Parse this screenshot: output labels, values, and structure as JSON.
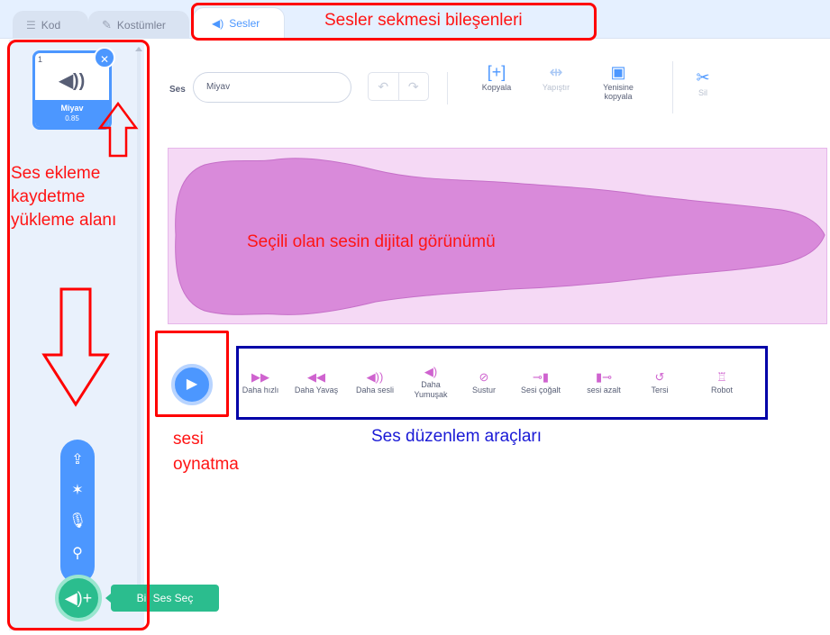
{
  "tabs": {
    "code": {
      "label": "Kod",
      "icon": "code-icon"
    },
    "costumes": {
      "label": "Kostümler",
      "icon": "brush-icon"
    },
    "sounds": {
      "label": "Sesler",
      "icon": "speaker-icon"
    }
  },
  "sound_list": {
    "items": [
      {
        "index": "1",
        "name": "Miyav",
        "duration": "0.85"
      }
    ],
    "delete_icon": "trash-icon",
    "add_menu": {
      "items": [
        "upload-icon",
        "surprise-icon",
        "record-icon",
        "search-icon"
      ],
      "main_icon": "add-sound-icon",
      "tooltip": "Bir Ses Seç"
    }
  },
  "toolbar": {
    "sound_label": "Ses",
    "sound_name_value": "Miyav",
    "undo_icon": "undo-icon",
    "redo_icon": "redo-icon",
    "copy_label": "Kopyala",
    "paste_label": "Yapıştır",
    "copy_new_label_1": "Yenisine",
    "copy_new_label_2": "kopyala",
    "delete_label": "Sil"
  },
  "effects": {
    "faster": "Daha hızlı",
    "slower": "Daha Yavaş",
    "louder": "Daha sesli",
    "softer_1": "Daha",
    "softer_2": "Yumuşak",
    "mute": "Sustur",
    "fade_in": "Sesi çoğalt",
    "fade_out": "sesi azalt",
    "reverse": "Tersi",
    "robot": "Robot"
  },
  "annotations": {
    "tab_components": "Sesler sekmesi bileşenleri",
    "add_area_1": "Ses ekleme",
    "add_area_2": "kaydetme",
    "add_area_3": "yükleme alanı",
    "waveform": "Seçili olan sesin dijital görünümü",
    "play_1": "sesi",
    "play_2": "oynatma",
    "effects": "Ses düzenlem araçları"
  },
  "colors": {
    "accent": "#4c97ff",
    "waveform_fill": "#d98ada",
    "add_button": "#2bbd8e",
    "annotation_red": "#ff0000",
    "annotation_blue": "#0000a8"
  }
}
